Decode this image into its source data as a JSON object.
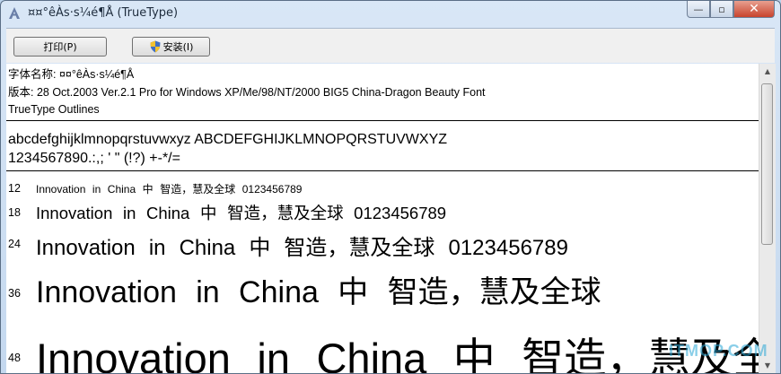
{
  "window": {
    "title": "¤¤°êÀs·s¼é¶Å (TrueType)",
    "icon": "font-file-icon",
    "caption_buttons": {
      "minimize": "—",
      "maximize": "▫",
      "close": "✕"
    }
  },
  "toolbar": {
    "print_label": "打印(P)",
    "install_label": "安装(I)",
    "install_icon": "uac-shield-icon"
  },
  "info": {
    "font_name": "字体名称: ¤¤°êÀs·s¼é¶Å",
    "version": "版本: 28 Oct.2003 Ver.2.1 Pro for Windows XP/Me/98/NT/2000 BIG5 China-Dragon Beauty Font",
    "outline": "TrueType Outlines"
  },
  "charset": {
    "letters": "abcdefghijklmnopqrstuvwxyz ABCDEFGHIJKLMNOPQRSTUVWXYZ",
    "digits": "1234567890.:,; ' \" (!?) +-*/="
  },
  "samples": [
    {
      "size": "12",
      "text": "Innovation in China 中 智造，慧及全球 0123456789"
    },
    {
      "size": "18",
      "text": "Innovation in China 中 智造，慧及全球 0123456789"
    },
    {
      "size": "24",
      "text": "Innovation in China 中 智造，慧及全球 0123456789"
    },
    {
      "size": "36",
      "text": "Innovation in China 中 智造，慧及全球"
    },
    {
      "size": "48",
      "text": "Innovation in China 中 智造，慧及全球"
    }
  ],
  "watermark": "ITMOP.COM",
  "colors": {
    "accent": "#2aa7d6",
    "close_button": "#c8432d",
    "title_bar": "#c4d8ef"
  }
}
